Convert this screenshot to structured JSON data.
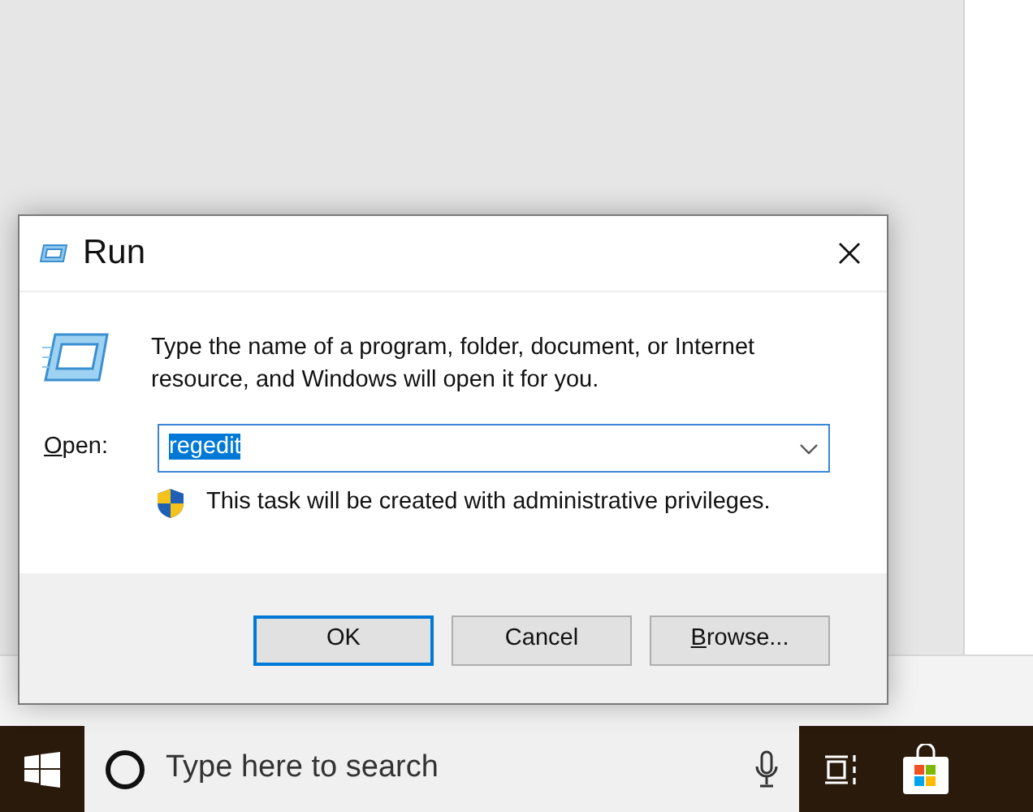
{
  "dialog": {
    "title": "Run",
    "description": "Type the name of a program, folder, document, or Internet resource, and Windows will open it for you.",
    "open_label": "Open:",
    "open_value": "regedit",
    "value_selected": true,
    "admin_note": "This task will be created with administrative privileges.",
    "buttons": [
      {
        "label": "OK",
        "default": true
      },
      {
        "label": "Cancel",
        "default": false
      },
      {
        "label": "Browse...",
        "default": false
      }
    ]
  },
  "taskbar": {
    "search": {
      "placeholder": "Type here to search"
    }
  }
}
